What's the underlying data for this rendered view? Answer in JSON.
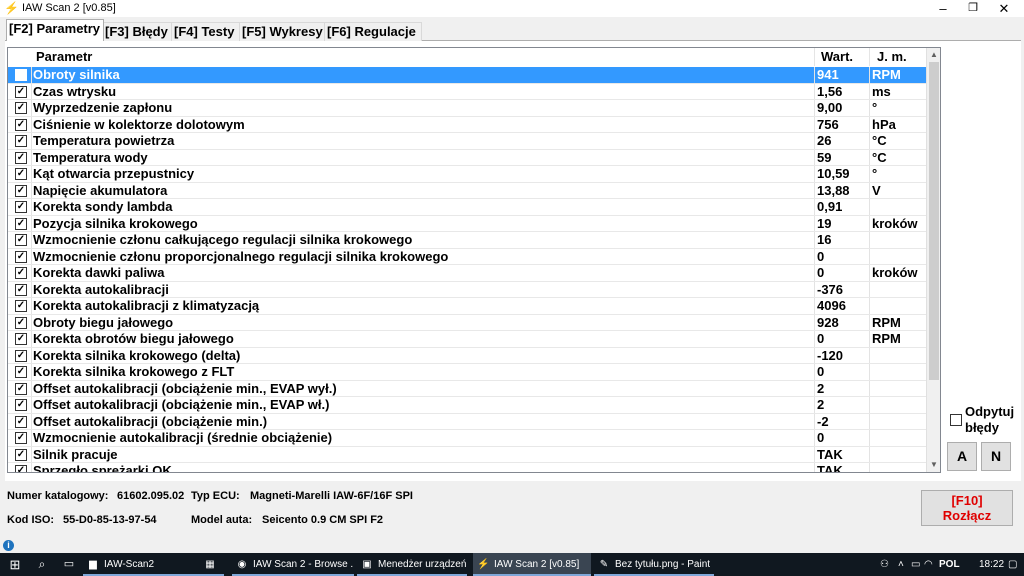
{
  "window": {
    "title": "IAW Scan 2 [v0.85]",
    "minimize": "–",
    "maximize": "❐",
    "close": "✕"
  },
  "tabs": [
    {
      "label": "[F2] Parametry",
      "active": true
    },
    {
      "label": "[F3] Błędy",
      "active": false
    },
    {
      "label": "[F4] Testy",
      "active": false
    },
    {
      "label": "[F5] Wykresy",
      "active": false
    },
    {
      "label": "[F6] Regulacje",
      "active": false
    }
  ],
  "table": {
    "headers": {
      "name": "Parametr",
      "value": "Wart.",
      "unit": "J. m."
    },
    "rows": [
      {
        "checked": true,
        "name": "Obroty silnika",
        "value": "941",
        "unit": "RPM",
        "selected": true
      },
      {
        "checked": true,
        "name": "Czas wtrysku",
        "value": "1,56",
        "unit": "ms"
      },
      {
        "checked": true,
        "name": "Wyprzedzenie zapłonu",
        "value": "9,00",
        "unit": "°"
      },
      {
        "checked": true,
        "name": "Ciśnienie w kolektorze dolotowym",
        "value": "756",
        "unit": "hPa"
      },
      {
        "checked": true,
        "name": "Temperatura powietrza",
        "value": "26",
        "unit": "°C"
      },
      {
        "checked": true,
        "name": "Temperatura wody",
        "value": "59",
        "unit": "°C"
      },
      {
        "checked": true,
        "name": "Kąt otwarcia przepustnicy",
        "value": "10,59",
        "unit": "°"
      },
      {
        "checked": true,
        "name": "Napięcie akumulatora",
        "value": "13,88",
        "unit": "V"
      },
      {
        "checked": true,
        "name": "Korekta sondy lambda",
        "value": "0,91",
        "unit": ""
      },
      {
        "checked": true,
        "name": "Pozycja silnika krokowego",
        "value": "19",
        "unit": "kroków"
      },
      {
        "checked": true,
        "name": "Wzmocnienie członu całkującego regulacji silnika krokowego",
        "value": "16",
        "unit": ""
      },
      {
        "checked": true,
        "name": "Wzmocnienie członu proporcjonalnego regulacji silnika krokowego",
        "value": "0",
        "unit": ""
      },
      {
        "checked": true,
        "name": "Korekta dawki paliwa",
        "value": "0",
        "unit": "kroków"
      },
      {
        "checked": true,
        "name": "Korekta autokalibracji",
        "value": "-376",
        "unit": ""
      },
      {
        "checked": true,
        "name": "Korekta autokalibracji z klimatyzacją",
        "value": "4096",
        "unit": ""
      },
      {
        "checked": true,
        "name": "Obroty biegu jałowego",
        "value": "928",
        "unit": "RPM"
      },
      {
        "checked": true,
        "name": "Korekta obrotów biegu jałowego",
        "value": "0",
        "unit": "RPM"
      },
      {
        "checked": true,
        "name": "Korekta silnika krokowego (delta)",
        "value": "-120",
        "unit": ""
      },
      {
        "checked": true,
        "name": "Korekta silnika krokowego z FLT",
        "value": "0",
        "unit": ""
      },
      {
        "checked": true,
        "name": "Offset autokalibracji (obciążenie min., EVAP wył.)",
        "value": "2",
        "unit": ""
      },
      {
        "checked": true,
        "name": "Offset autokalibracji (obciążenie min., EVAP wł.)",
        "value": "2",
        "unit": ""
      },
      {
        "checked": true,
        "name": "Offset autokalibracji (obciążenie min.)",
        "value": "-2",
        "unit": ""
      },
      {
        "checked": true,
        "name": "Wzmocnienie autokalibracji (średnie obciążenie)",
        "value": "0",
        "unit": ""
      },
      {
        "checked": true,
        "name": "Silnik pracuje",
        "value": "TAK",
        "unit": ""
      },
      {
        "checked": true,
        "name": "Sprzęgło sprężarki OK",
        "value": "TAK",
        "unit": ""
      }
    ]
  },
  "side": {
    "odpytuj_label": "Odpytuj błędy",
    "btn_a": "A",
    "btn_n": "N"
  },
  "status": {
    "catalog_label": "Numer katalogowy:",
    "catalog_value": "61602.095.02",
    "ecu_label": "Typ ECU:",
    "ecu_value": "Magneti-Marelli IAW-6F/16F SPI",
    "iso_label": "Kod ISO:",
    "iso_value": "55-D0-85-13-97-54",
    "model_label": "Model auta:",
    "model_value": "Seicento 0.9 CM SPI F2"
  },
  "disconnect": {
    "line1": "[F10]",
    "line2": "Rozłącz"
  },
  "taskbar": {
    "apps": [
      {
        "label": "IAW-Scan2",
        "icon": "folder-icon"
      },
      {
        "label": "",
        "icon": "calculator-icon"
      },
      {
        "label": "IAW Scan 2 - Browse ...",
        "icon": "chrome-icon"
      },
      {
        "label": "Menedżer urządzeń",
        "icon": "device-manager-icon"
      },
      {
        "label": "IAW Scan 2 [v0.85]",
        "icon": "iaw-scan-icon",
        "active": true
      },
      {
        "label": "Bez tytułu.png - Paint",
        "icon": "paint-icon"
      }
    ],
    "lang": "POL",
    "time": "18:22"
  }
}
